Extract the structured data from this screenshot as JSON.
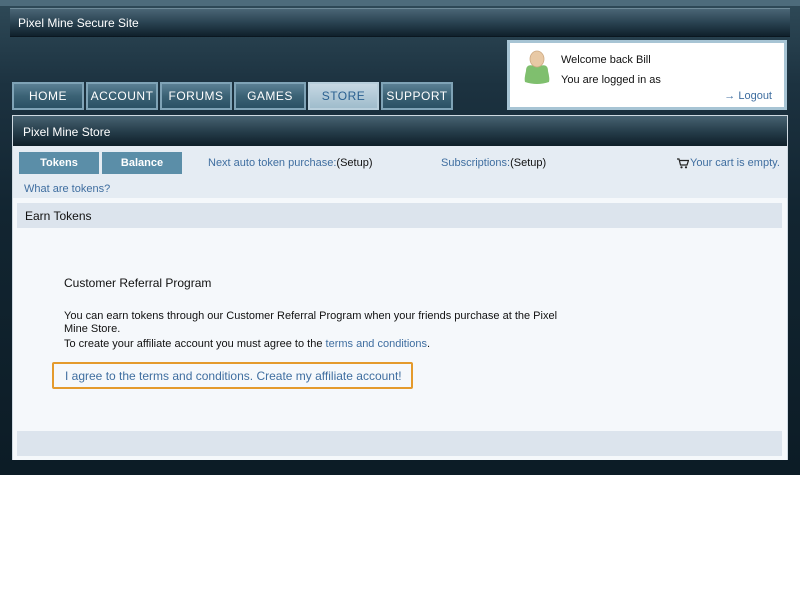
{
  "site": {
    "title": "Pixel Mine Secure Site"
  },
  "nav": {
    "items": [
      {
        "label": "HOME",
        "active": false
      },
      {
        "label": "ACCOUNT",
        "active": false
      },
      {
        "label": "FORUMS",
        "active": false
      },
      {
        "label": "GAMES",
        "active": false
      },
      {
        "label": "STORE",
        "active": true
      },
      {
        "label": "SUPPORT",
        "active": false
      }
    ]
  },
  "user": {
    "welcome_prefix": "Welcome back",
    "name": "Bill",
    "logged_in_text": "You are logged in as",
    "logout_arrow": "→",
    "logout_label": "Logout"
  },
  "store": {
    "title": "Pixel Mine Store",
    "tokens_label": "Tokens",
    "balance_label": "Balance",
    "auto_token_label": "Next auto token purchase:",
    "auto_token_value": "(Setup)",
    "subscriptions_label": "Subscriptions:",
    "subscriptions_value": "(Setup)",
    "cart_text": "Your cart is empty.",
    "what_tokens": "What are tokens?"
  },
  "earn": {
    "section_title": "Earn Tokens",
    "program_title": "Customer Referral Program",
    "description": "You can earn tokens through our Customer Referral Program when your friends purchase at the Pixel Mine Store.",
    "agree_prefix": "To create your affiliate account you must agree to the",
    "terms_link": "terms and conditions",
    "agree_suffix": ".",
    "agree_button": "I agree to the terms and conditions. Create my affiliate account!"
  },
  "colors": {
    "link": "#3f6ea0",
    "button": "#5b8ea8",
    "highlight_border": "#e49a2c",
    "header_dark": "#0c1c26"
  }
}
